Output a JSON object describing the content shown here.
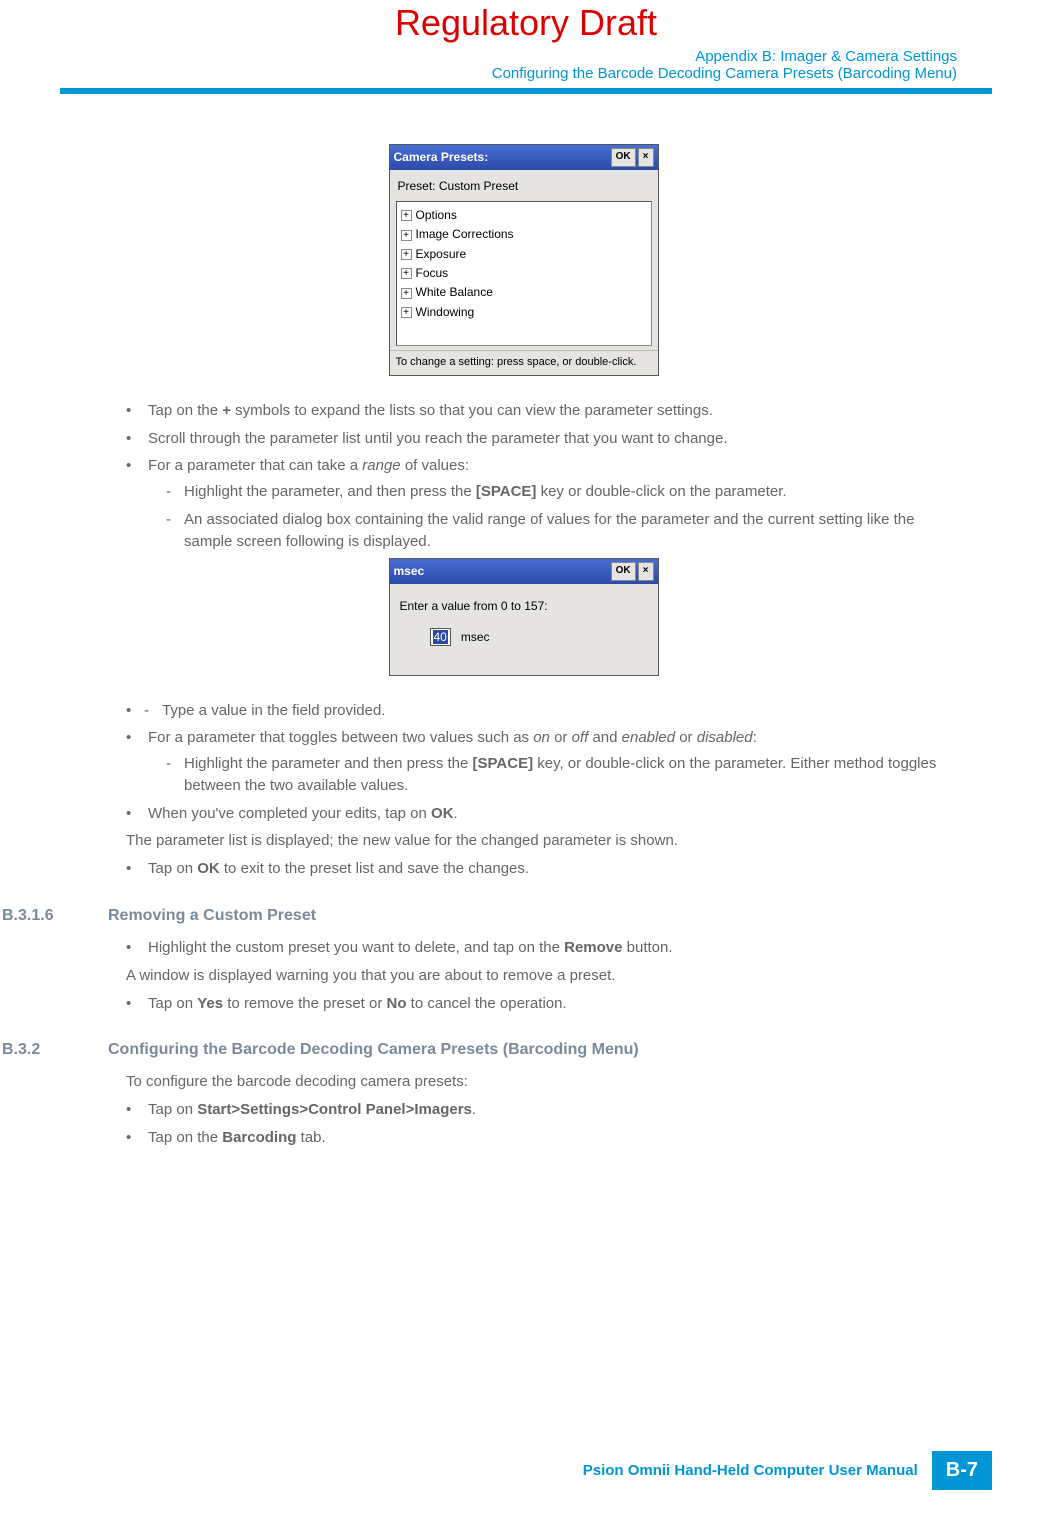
{
  "draft": "Regulatory Draft",
  "header": {
    "line1": "Appendix B: Imager & Camera Settings",
    "line2": "Configuring the Barcode Decoding Camera Presets (Barcoding Menu)"
  },
  "dialog1": {
    "title": "Camera Presets:",
    "ok": "OK",
    "close": "×",
    "preset_label": "Preset:  Custom Preset",
    "tree": [
      "Options",
      "Image Corrections",
      "Exposure",
      "Focus",
      "White Balance",
      "Windowing"
    ],
    "status": "To change a setting: press space, or double-click."
  },
  "body": {
    "b1a": "Tap on the ",
    "b1b": "+",
    "b1c": " symbols to expand the lists so that you can view the parameter settings.",
    "b2": "Scroll through the parameter list until you reach the parameter that you want to change.",
    "b3a": "For a parameter that can take a ",
    "b3b": "range",
    "b3c": " of values:",
    "d1a": "Highlight the parameter, and then press the ",
    "d1b": "[SPACE]",
    "d1c": " key or double-click on the parameter.",
    "d2": "An associated dialog box containing the valid range of values for the parameter and the current setting like the sample screen following is displayed."
  },
  "dialog2": {
    "title": "msec",
    "ok": "OK",
    "close": "×",
    "prompt": "Enter a value from 0 to 157:",
    "value": "40",
    "unit": "msec"
  },
  "body2": {
    "d3": "Type a value in the field provided.",
    "b4a": "For a parameter that toggles between two values such as ",
    "on": "on",
    "or1": " or ",
    "off": "off",
    "and": " and ",
    "enabled": "enabled",
    "or2": " or ",
    "disabled": "disabled",
    "colon": ":",
    "d4a": "Highlight the parameter and then press the ",
    "d4b": "[SPACE]",
    "d4c": " key, or double-click on the parameter. Either method toggles between the two available values.",
    "b5a": "When you've completed your edits, tap on ",
    "b5b": "OK",
    "b5c": ".",
    "p1": "The parameter list is displayed; the new value for the changed parameter is shown.",
    "b6a": "Tap on ",
    "b6b": "OK",
    "b6c": " to exit to the preset list and save the changes."
  },
  "sec316": {
    "num": "B.3.1.6",
    "title": "Removing a Custom Preset",
    "b1a": "Highlight the custom preset you want to delete, and tap on the ",
    "b1b": "Remove",
    "b1c": " button.",
    "p1": "A window is displayed warning you that you are about to remove a preset.",
    "b2a": "Tap on ",
    "b2b": "Yes",
    "b2c": " to remove the preset or ",
    "b2d": "No",
    "b2e": " to cancel the operation."
  },
  "sec32": {
    "num": "B.3.2",
    "title": "Configuring the Barcode Decoding Camera Presets (Barcoding Menu)",
    "p1": "To configure the barcode decoding camera presets:",
    "b1a": "Tap on ",
    "b1b": "Start>Settings>Control Panel>Imagers",
    "b1c": ".",
    "b2a": "Tap on the ",
    "b2b": "Barcoding",
    "b2c": " tab."
  },
  "footer": {
    "text": "Psion Omnii Hand-Held Computer User Manual",
    "page": "B-7"
  }
}
